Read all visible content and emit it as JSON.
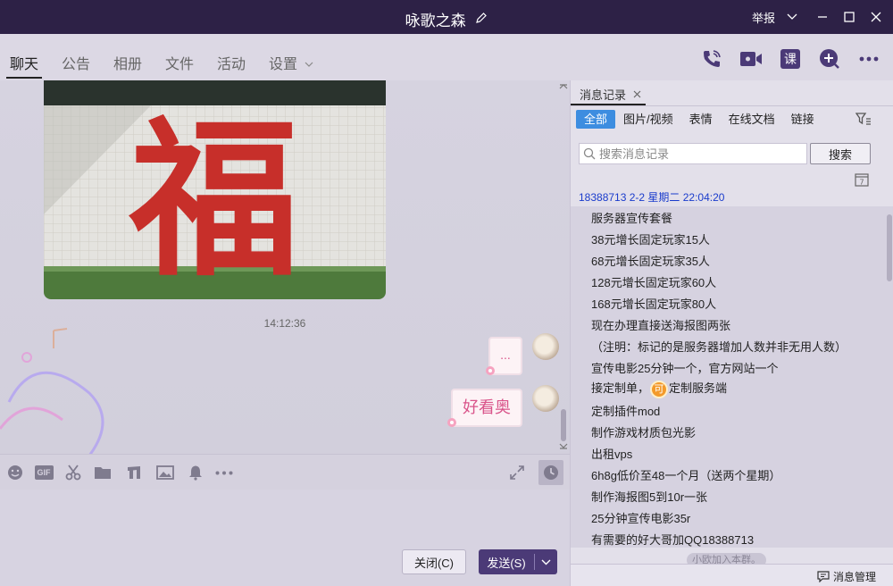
{
  "window": {
    "title": "咏歌之森",
    "report_label": "举报"
  },
  "tabs": [
    {
      "label": "聊天",
      "active": true
    },
    {
      "label": "公告"
    },
    {
      "label": "相册"
    },
    {
      "label": "文件"
    },
    {
      "label": "活动"
    },
    {
      "label": "设置"
    }
  ],
  "header_actions": {
    "class_label": "课"
  },
  "chat": {
    "photo_text": "福",
    "timestamp": "14:12:36",
    "messages": [
      {
        "text": "...",
        "from": "self"
      },
      {
        "text": "好看奥",
        "from": "self"
      }
    ]
  },
  "toolbar": {
    "gif_label": "GIF",
    "icons": [
      "emoji-icon",
      "gif-icon",
      "scissors-icon",
      "folder-icon",
      "music-icon",
      "image-icon",
      "bell-icon",
      "more-icon"
    ]
  },
  "input": {
    "close_label": "关闭(C)",
    "send_label": "发送(S)"
  },
  "history": {
    "tab_label": "消息记录",
    "filters": [
      "全部",
      "图片/视频",
      "表情",
      "在线文档",
      "链接"
    ],
    "search_placeholder": "搜索消息记录",
    "search_button": "搜索",
    "calendar_label": "7",
    "header": "18388713 2-2 星期二 22:04:20",
    "lines": [
      "服务器宣传套餐",
      "38元增长固定玩家15人",
      "68元增长固定玩家35人",
      "128元增长固定玩家60人",
      "168元增长固定玩家80人",
      "现在办理直接送海报图两张",
      "（注明：标记的是服务器增加人数并非无用人数）",
      "宣传电影25分钟一个，官方网站一个",
      "接定制单，",
      "定制插件mod",
      "制作游戏材质包光影",
      "出租vps",
      "6h8g低价至48一个月（送两个星期）",
      "制作海报图5到10r一张",
      "25分钟宣传电影35r",
      "有需要的好大哥加QQ18388713"
    ],
    "inline_emoji": "可",
    "line_tail": "定制服务端",
    "join_tag": "小欧加入本群。",
    "manage_label": "消息管理"
  },
  "colors": {
    "titlebar": "#2d2146",
    "send_button": "#4b3a77",
    "filter_active": "#3d8de0",
    "bubble_text": "#d9548a",
    "history_header": "#1a3ccc"
  }
}
